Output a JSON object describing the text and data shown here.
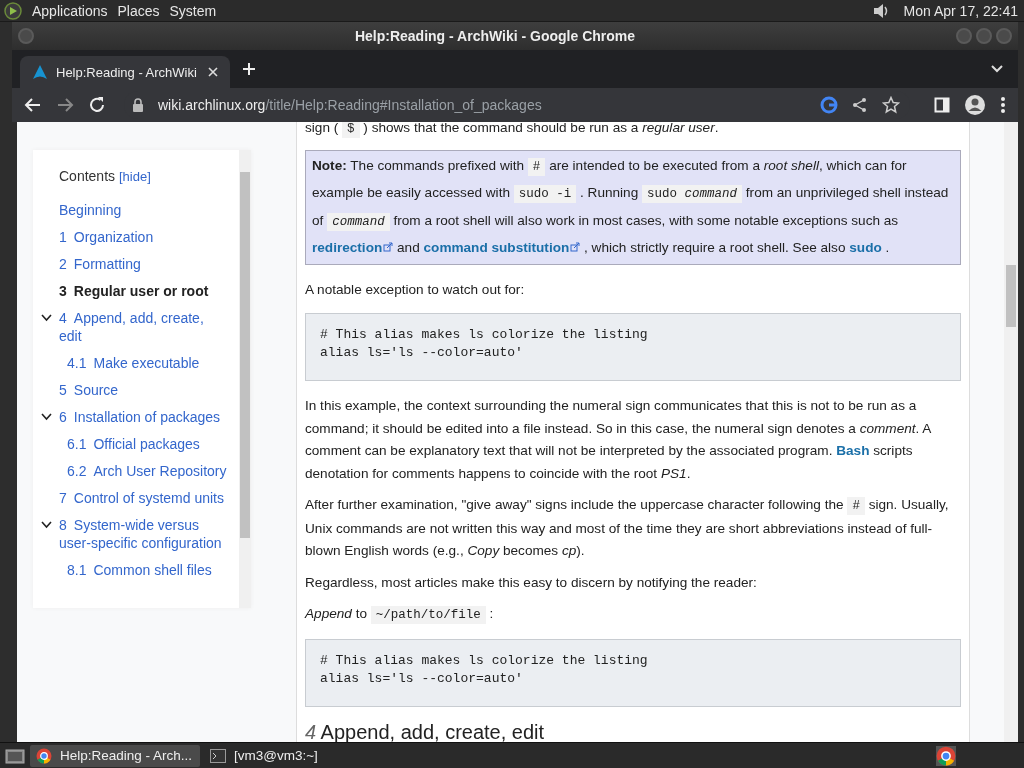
{
  "top_panel": {
    "menus": [
      "Applications",
      "Places",
      "System"
    ],
    "clock": "Mon Apr 17, 22:41"
  },
  "window": {
    "title": "Help:Reading - ArchWiki - Google Chrome"
  },
  "tabs": [
    {
      "label": "Help:Reading - ArchWiki",
      "selected": true
    }
  ],
  "address_bar": {
    "host": "wiki.archlinux.org",
    "path": "/title/Help:Reading#Installation_of_packages"
  },
  "toc": {
    "title": "Contents",
    "toggle": "[hide]",
    "items": [
      {
        "label": "Beginning",
        "selected": false
      },
      {
        "number": "1",
        "label": "Organization",
        "selected": false
      },
      {
        "number": "2",
        "label": "Formatting",
        "selected": false
      },
      {
        "number": "3",
        "label": "Regular user or root",
        "selected": true
      },
      {
        "number": "4",
        "label": "Append, add, create, edit",
        "selected": false,
        "expanded": true,
        "children": [
          {
            "number": "4.1",
            "label": "Make executable",
            "selected": false
          }
        ]
      },
      {
        "number": "5",
        "label": "Source",
        "selected": false
      },
      {
        "number": "6",
        "label": "Installation of packages",
        "selected": false,
        "expanded": true,
        "children": [
          {
            "number": "6.1",
            "label": "Official packages",
            "selected": false
          },
          {
            "number": "6.2",
            "label": "Arch User Repository",
            "selected": false
          }
        ]
      },
      {
        "number": "7",
        "label": "Control of systemd units",
        "selected": false
      },
      {
        "number": "8",
        "label": "System-wide versus user-specific configuration",
        "selected": false,
        "expanded": true,
        "children": [
          {
            "number": "8.1",
            "label": "Common shell files",
            "selected": false
          }
        ]
      }
    ]
  },
  "article": {
    "blocks": [
      {
        "kind": "paragraph",
        "segments": [
          {
            "kind": "text",
            "text": "sign ("
          },
          {
            "kind": "code",
            "text": "$"
          },
          {
            "kind": "text",
            "text": ") shows that the command should be run as a *regular user*."
          }
        ]
      },
      {
        "kind": "note",
        "segments": [
          {
            "kind": "text",
            "text": "**Note:** The commands prefixed with"
          },
          {
            "kind": "code",
            "text": "#"
          },
          {
            "kind": "text",
            "text": "are intended to be executed from a *root shell*, which can for example be easily accessed with"
          },
          {
            "kind": "code",
            "text": "sudo -i"
          },
          {
            "kind": "text",
            "text": ". Running"
          },
          {
            "kind": "code",
            "text": "sudo *command*"
          },
          {
            "kind": "text",
            "text": "from an unprivileged shell instead of"
          },
          {
            "kind": "code",
            "text": "*command*"
          },
          {
            "kind": "text",
            "text": "from a root shell will also work in most cases, with some notable exceptions such as"
          },
          {
            "kind": "external_link",
            "text": "redirection"
          },
          {
            "kind": "text",
            "text": "and"
          },
          {
            "kind": "external_link",
            "text": "command substitution"
          },
          {
            "kind": "text",
            "text": ", which strictly require a root shell. See also"
          },
          {
            "kind": "link",
            "text": "sudo"
          },
          {
            "kind": "text",
            "text": "."
          }
        ]
      },
      {
        "kind": "paragraph",
        "segments": [
          {
            "kind": "text",
            "text": "A notable exception to watch out for:"
          }
        ]
      },
      {
        "kind": "code",
        "lines": [
          "# This alias makes ls colorize the listing",
          "alias ls='ls --color=auto'"
        ]
      },
      {
        "kind": "paragraph",
        "segments": [
          {
            "kind": "text",
            "text": "In this example, the context surrounding the numeral sign communicates that this is not to be run as a command; it should be edited into a file instead. So in this case, the numeral sign denotes a *comment*. A comment can be explanatory text that will not be interpreted by the associated program."
          },
          {
            "kind": "link",
            "text": "Bash"
          },
          {
            "kind": "text",
            "text": "scripts denotation for comments happens to coincide with the root *PS1*."
          }
        ]
      },
      {
        "kind": "paragraph",
        "segments": [
          {
            "kind": "text",
            "text": "After further examination, \"give away\" signs include the uppercase character following the"
          },
          {
            "kind": "code",
            "text": "#"
          },
          {
            "kind": "text",
            "text": "sign. Usually, Unix commands are not written this way and most of the time they are short abbreviations instead of full-blown English words (e.g., *Copy* becomes *cp*)."
          }
        ]
      },
      {
        "kind": "paragraph",
        "segments": [
          {
            "kind": "text",
            "text": "Regardless, most articles make this easy to discern by notifying the reader:"
          }
        ]
      },
      {
        "kind": "paragraph",
        "segments": [
          {
            "kind": "text",
            "text": "*Append* to"
          },
          {
            "kind": "code",
            "text": "~/path/to/file"
          },
          {
            "kind": "text",
            "text": ":"
          }
        ]
      },
      {
        "kind": "code",
        "lines": [
          "# This alias makes ls colorize the listing",
          "alias ls='ls --color=auto'"
        ]
      },
      {
        "kind": "heading",
        "number": "4",
        "text": "Append, add, create, edit"
      }
    ]
  },
  "taskbar": {
    "items": [
      {
        "kind": "browser",
        "label": "Help:Reading - Arch...",
        "selected": true
      },
      {
        "kind": "terminal",
        "label": "[vm3@vm3:~]",
        "selected": false
      }
    ]
  }
}
